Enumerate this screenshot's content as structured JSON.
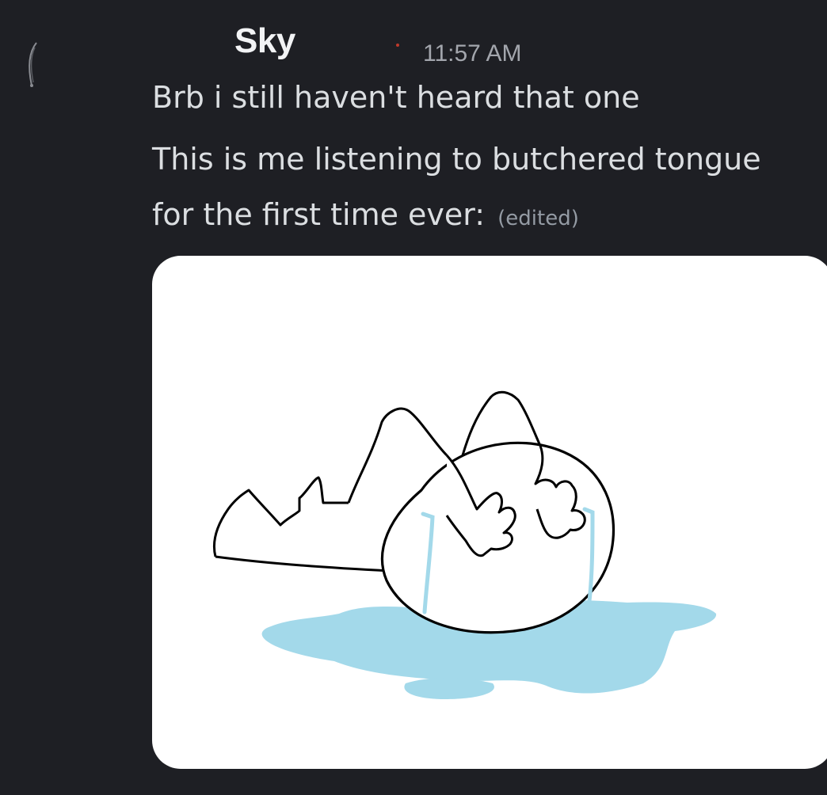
{
  "message": {
    "author": "Sky",
    "timestamp": "11:57 AM",
    "lines": [
      "Brb i still haven't heard that one",
      "This is me listening to butchered tongue",
      "for the first time ever:"
    ],
    "edited_label": "(edited)"
  },
  "colors": {
    "background": "#1e1f24",
    "username": "#f2f3f5",
    "message_text": "#dbdee1",
    "timestamp": "#a3a6ad",
    "edited": "#949ba4",
    "tear_puddle": "#a3d9ea"
  },
  "attachment": {
    "kind": "image"
  }
}
